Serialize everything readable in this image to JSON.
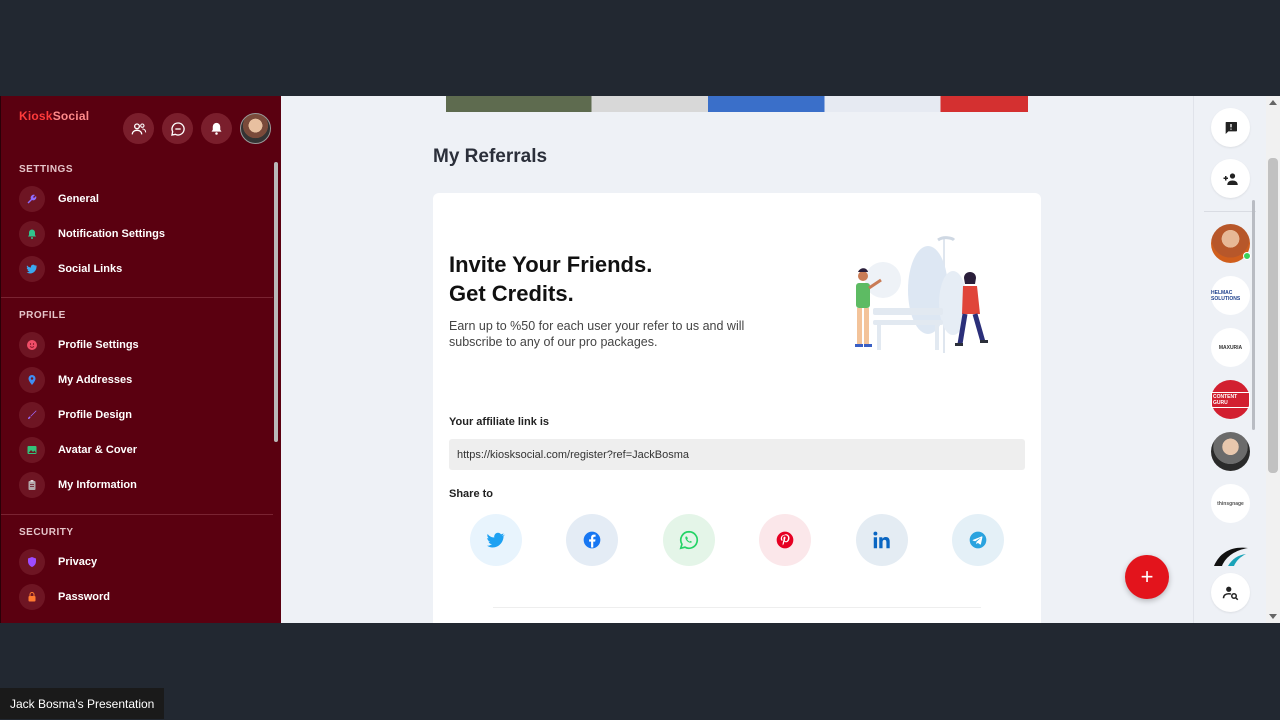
{
  "sidebar": {
    "logo_part1": "Kiosk",
    "logo_part2": "Social",
    "sections": {
      "settings": "SETTINGS",
      "profile": "PROFILE",
      "security": "SECURITY"
    },
    "items": {
      "general": "General",
      "notification_settings": "Notification Settings",
      "social_links": "Social Links",
      "profile_settings": "Profile Settings",
      "my_addresses": "My Addresses",
      "profile_design": "Profile Design",
      "avatar_cover": "Avatar & Cover",
      "my_information": "My Information",
      "privacy": "Privacy",
      "password": "Password"
    }
  },
  "main": {
    "page_title": "My Referrals",
    "headline_line1": "Invite Your Friends.",
    "headline_line2": "Get Credits.",
    "description": "Earn up to %50 for each user your refer to us and will subscribe to any of our pro packages.",
    "affiliate_label": "Your affiliate link is",
    "affiliate_link": "https://kiosksocial.com/register?ref=JackBosma",
    "share_label": "Share to"
  },
  "share_colors": {
    "twitter": "#1da1f2",
    "facebook": "#1877f2",
    "whatsapp": "#25d366",
    "pinterest": "#e60023",
    "linkedin": "#0a66c2",
    "telegram": "#2aa3df"
  },
  "rail": {
    "company1": "HELMAC SOLUTIONS",
    "company2": "MAXURIA",
    "company3": "CONTENT GURU",
    "company4": "thinsgnage"
  },
  "fab_symbol": "+",
  "presenter": "Jack Bosma's Presentation"
}
